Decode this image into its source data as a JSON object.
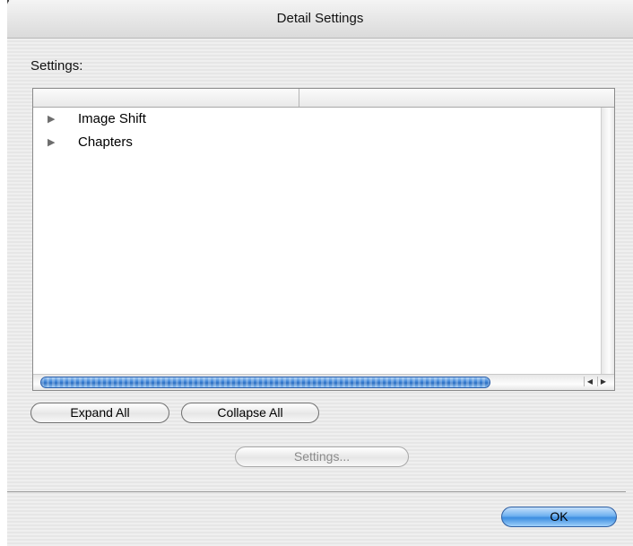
{
  "window": {
    "title": "Detail Settings"
  },
  "settings_label": "Settings:",
  "table": {
    "columns": [
      "",
      ""
    ],
    "rows": [
      {
        "label": "Image Shift",
        "expanded": false
      },
      {
        "label": "Chapters",
        "expanded": false
      }
    ]
  },
  "buttons": {
    "expand_all": "Expand All",
    "collapse_all": "Collapse All",
    "settings": "Settings...",
    "ok": "OK"
  },
  "colors": {
    "accent": "#3c8de0"
  }
}
